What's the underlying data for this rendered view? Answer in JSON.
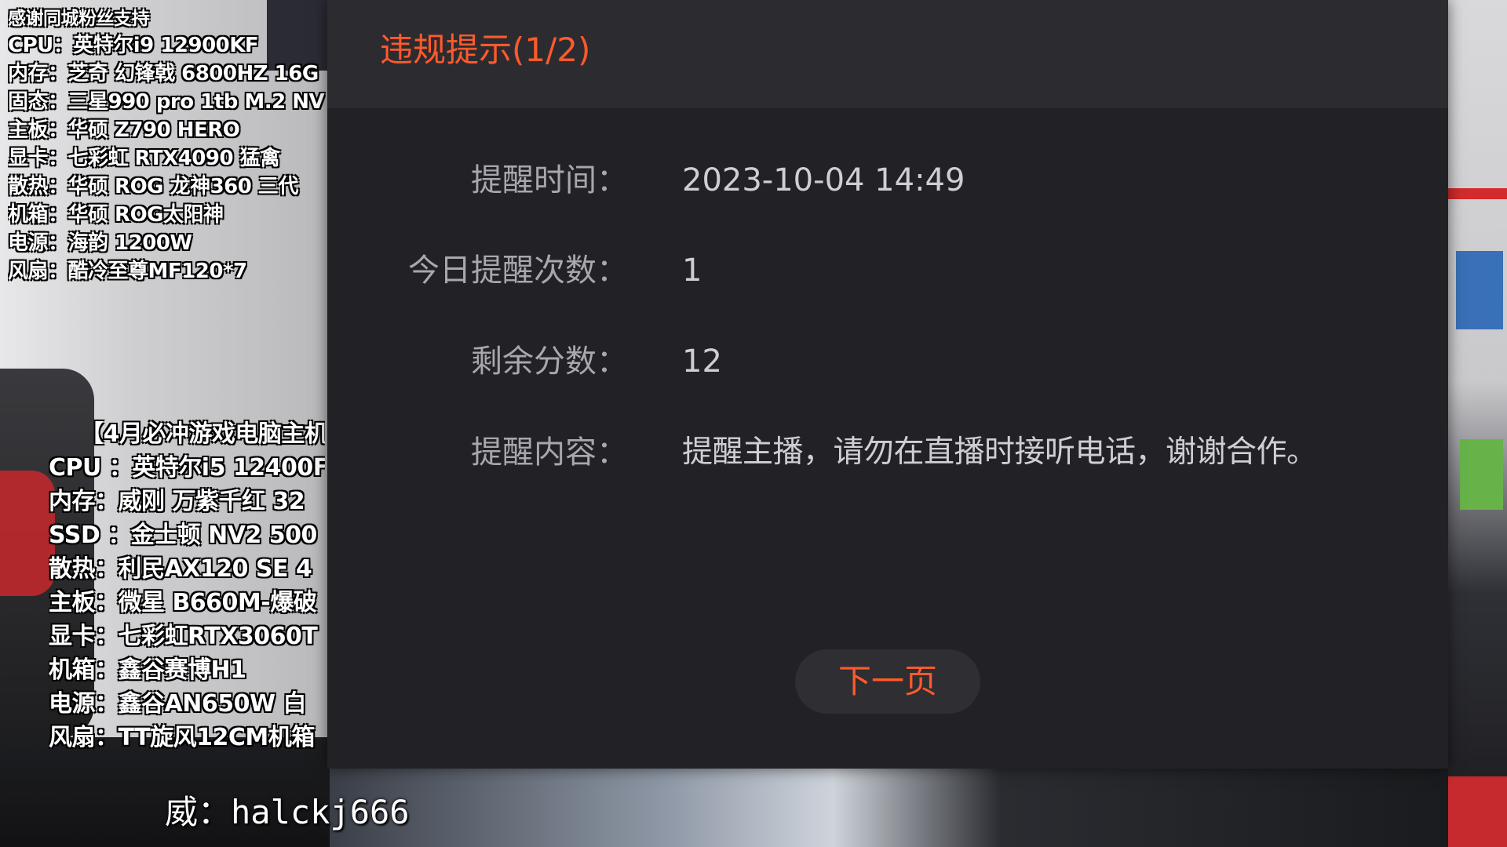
{
  "dialog": {
    "title": "违规提示(1/2)",
    "rows": [
      {
        "label": "提醒时间：",
        "value": "2023-10-04 14:49"
      },
      {
        "label": "今日提醒次数：",
        "value": "1"
      },
      {
        "label": "剩余分数：",
        "value": "12"
      },
      {
        "label": "提醒内容：",
        "value": "提醒主播，请勿在直播时接听电话，谢谢合作。"
      }
    ],
    "next_label": "下一页",
    "accent_color": "#ff5a2c",
    "background_color": "#222226"
  },
  "overlay": {
    "top_lines": [
      "感谢同城粉丝支持",
      "CPU：英特尔i9 12900KF",
      "内存：芝奇 幻锋戟 6800HZ 16G",
      "固态：三星990 pro 1tb  M.2 NV",
      "主板：华硕 Z790 HERO",
      "显卡：七彩虹 RTX4090 猛禽",
      "散热：华硕 ROG 龙神360 三代",
      "机箱：华硕 ROG太阳神",
      "电源：海韵 1200W",
      "风扇：酷冷至尊MF120*7"
    ],
    "mid_lines": [
      "【4月必冲游戏电脑主机",
      "CPU  ：英特尔i5 12400F",
      "内存：威刚 万紫千红 32",
      "SSD  ：金士顿 NV2 500",
      "散热：利民AX120 SE 4",
      "主板：微星 B660M-爆破",
      "显卡：七彩虹RTX3060T",
      "机箱：鑫谷赛博H1",
      "电源：鑫谷AN650W 白",
      "风扇：TT旋风12CM机箱"
    ],
    "watermark": "威：halckj666"
  }
}
